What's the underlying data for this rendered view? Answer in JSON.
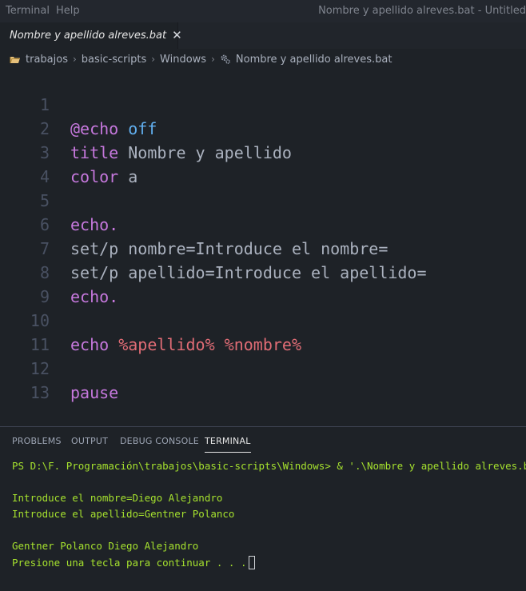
{
  "menu": {
    "terminal": "Terminal",
    "help": "Help"
  },
  "window_title": "Nombre y apellido alreves.bat - Untitled",
  "tab": {
    "label": "Nombre y apellido alreves.bat",
    "close": "✕",
    "icon": "gear-icon"
  },
  "breadcrumb": {
    "items": [
      "trabajos",
      "basic-scripts",
      "Windows",
      "Nombre y apellido alreves.bat"
    ],
    "separator": "›"
  },
  "editor": {
    "lines": [
      {
        "n": "1",
        "a": "@echo",
        "b": " off",
        "c": ""
      },
      {
        "n": "2",
        "a": "title",
        "b": " Nombre y apellido",
        "c": ""
      },
      {
        "n": "3",
        "a": "color",
        "b": " a",
        "c": ""
      },
      {
        "n": "4",
        "a": "",
        "b": "",
        "c": ""
      },
      {
        "n": "5",
        "a": "echo.",
        "b": "",
        "c": ""
      },
      {
        "n": "6",
        "a": "",
        "b": "set/p nombre=Introduce el nombre=",
        "c": ""
      },
      {
        "n": "7",
        "a": "",
        "b": "set/p apellido=Introduce el apellido=",
        "c": ""
      },
      {
        "n": "8",
        "a": "echo.",
        "b": "",
        "c": ""
      },
      {
        "n": "9",
        "a": "",
        "b": "",
        "c": ""
      },
      {
        "n": "10",
        "a": "echo",
        "b": " %apellido%",
        "c": " %nombre%"
      },
      {
        "n": "11",
        "a": "",
        "b": "",
        "c": ""
      },
      {
        "n": "12",
        "a": "pause",
        "b": "",
        "c": ""
      },
      {
        "n": "13",
        "a": "",
        "b": "",
        "c": ""
      }
    ]
  },
  "panel": {
    "tabs": [
      "PROBLEMS",
      "OUTPUT",
      "DEBUG CONSOLE",
      "TERMINAL"
    ],
    "active_tab": "TERMINAL"
  },
  "terminal": {
    "lines": [
      "PS D:\\F. Programación\\trabajos\\basic-scripts\\Windows> & '.\\Nombre y apellido alreves.bat'",
      "",
      "Introduce el nombre=Diego Alejandro",
      "Introduce el apellido=Gentner Polanco",
      "",
      "Gentner Polanco Diego Alejandro",
      "Presione una tecla para continuar . . ."
    ]
  },
  "colors": {
    "background": "#1e2227",
    "keyword": "#c678dd",
    "keyword_blue": "#61afef",
    "variable": "#e06c75",
    "terminal_text": "#a6e22e",
    "line_number": "#495162"
  }
}
